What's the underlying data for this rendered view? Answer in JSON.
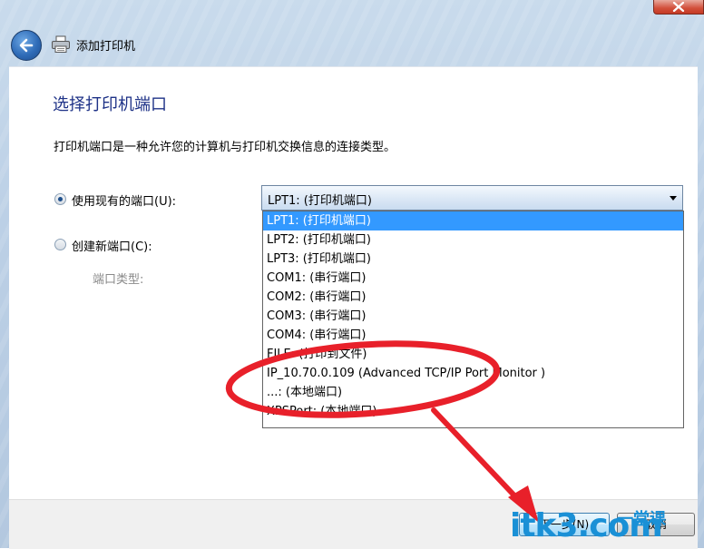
{
  "window": {
    "title": "添加打印机"
  },
  "page": {
    "heading": "选择打印机端口",
    "description": "打印机端口是一种允许您的计算机与打印机交换信息的连接类型。"
  },
  "options": {
    "existing_port_label": "使用现有的端口(U):",
    "existing_port_selected": true,
    "new_port_label": "创建新端口(C):",
    "new_port_selected": false,
    "port_type_label": "端口类型:"
  },
  "combo": {
    "value": "LPT1: (打印机端口)"
  },
  "dropdown": {
    "items": [
      "LPT1: (打印机端口)",
      "LPT2: (打印机端口)",
      "LPT3: (打印机端口)",
      "COM1: (串行端口)",
      "COM2: (串行端口)",
      "COM3: (串行端口)",
      "COM4: (串行端口)",
      "FILE: (打印到文件)",
      "IP_10.70.0.109 (Advanced TCP/IP Port Monitor )",
      "...: (本地端口)",
      "XPSPort: (本地端口)"
    ],
    "selected_index": 0
  },
  "buttons": {
    "next": "下一步(N)",
    "cancel": "取消"
  },
  "colors": {
    "heading": "#1e3287",
    "selection": "#3399ff",
    "annotation": "#e8202a",
    "watermark": "#1a90d6"
  },
  "watermark": {
    "main": "itk3.com",
    "cn": "一堂课"
  }
}
